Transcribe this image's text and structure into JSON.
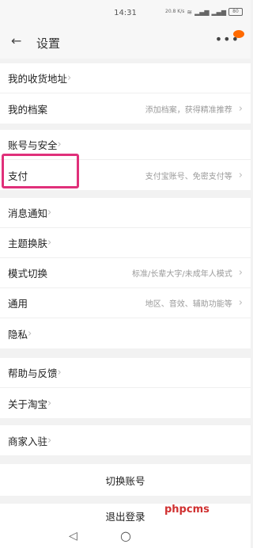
{
  "status_bar": {
    "time": "14:31",
    "net_speed": "20.8\nK/s",
    "battery": "80"
  },
  "header": {
    "title": "设置"
  },
  "groups": [
    [
      {
        "label": "我的收货地址",
        "hint": ""
      },
      {
        "label": "我的档案",
        "hint": "添加档案，获得精准推荐"
      }
    ],
    [
      {
        "label": "账号与安全",
        "hint": ""
      },
      {
        "label": "支付",
        "hint": "支付宝账号、免密支付等"
      }
    ],
    [
      {
        "label": "消息通知",
        "hint": ""
      },
      {
        "label": "主题换肤",
        "hint": ""
      },
      {
        "label": "模式切换",
        "hint": "标准/长辈大字/未成年人模式"
      },
      {
        "label": "通用",
        "hint": "地区、音效、辅助功能等"
      },
      {
        "label": "隐私",
        "hint": ""
      }
    ],
    [
      {
        "label": "帮助与反馈",
        "hint": ""
      },
      {
        "label": "关于淘宝",
        "hint": ""
      }
    ],
    [
      {
        "label": "商家入驻",
        "hint": ""
      }
    ]
  ],
  "buttons": {
    "switch_account": "切换账号",
    "logout": "退出登录"
  },
  "watermark": "phpcms",
  "accent_colors": {
    "highlight": "#e0307a",
    "badge": "#ff6a00"
  }
}
